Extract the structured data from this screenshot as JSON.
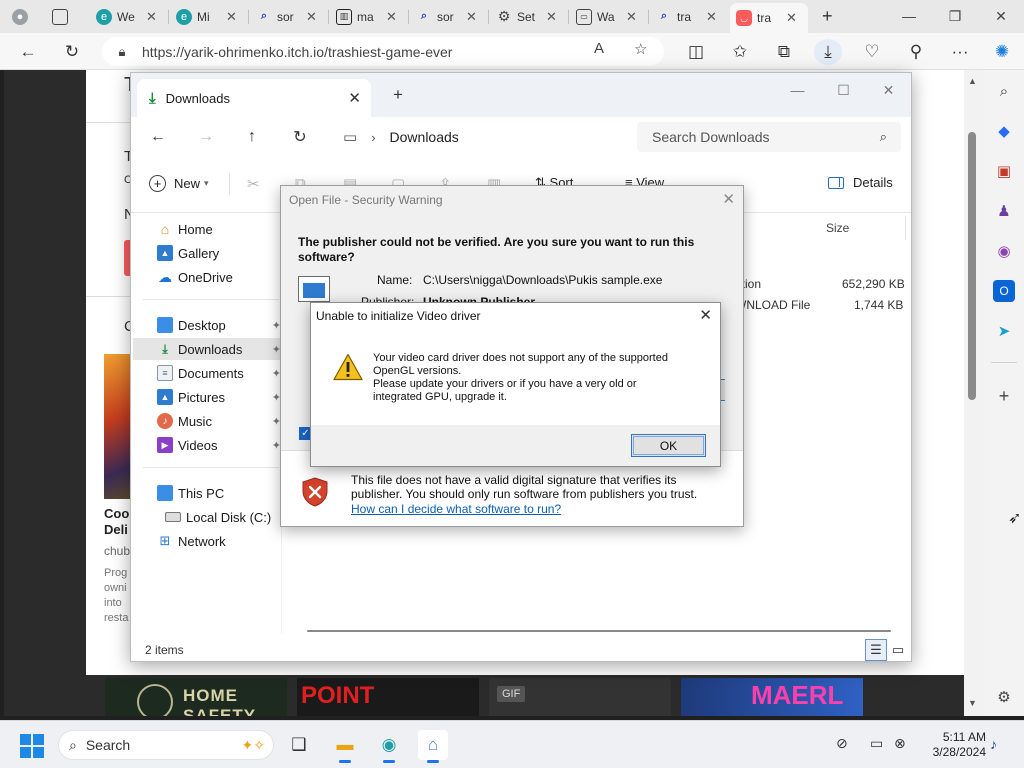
{
  "browser": {
    "tabs": [
      {
        "title": "We",
        "icon": "edge-icon"
      },
      {
        "title": "Mi",
        "icon": "edge-icon"
      },
      {
        "title": "sor",
        "icon": "search-icon"
      },
      {
        "title": "ma",
        "icon": "museum-icon"
      },
      {
        "title": "sor",
        "icon": "search-icon"
      },
      {
        "title": "Set",
        "icon": "gear-icon"
      },
      {
        "title": "Wa",
        "icon": "wallet-icon"
      },
      {
        "title": "tra",
        "icon": "search-icon"
      },
      {
        "title": "tra",
        "icon": "itch-icon"
      }
    ],
    "url": "https://yarik-ohrimenko.itch.io/trashiest-game-ever"
  },
  "page": {
    "card_left_title": "Coo",
    "card_left_title2": "Deli",
    "card_left_author": "chub",
    "card_left_desc": [
      "Prog",
      "owni",
      "into",
      "resta"
    ],
    "letter_t1": "T",
    "letter_t2": "T",
    "letter_c1": "C",
    "letter_n": "N",
    "letter_c2": "C",
    "thumbs": [
      "HOME SAFETY",
      "POINT",
      "GIF",
      "MAERL"
    ]
  },
  "explorer": {
    "tab_title": "Downloads",
    "breadcrumb": "Downloads",
    "search_placeholder": "Search Downloads",
    "new_label": "New",
    "sort_label": "Sort",
    "view_label": "View",
    "details_label": "Details",
    "nav": {
      "home": "Home",
      "gallery": "Gallery",
      "onedrive": "OneDrive",
      "desktop": "Desktop",
      "downloads": "Downloads",
      "documents": "Documents",
      "pictures": "Pictures",
      "music": "Music",
      "videos": "Videos",
      "this_pc": "This PC",
      "local_disk": "Local Disk (C:)",
      "network": "Network"
    },
    "column_size": "Size",
    "rows": [
      {
        "type": "ation",
        "size": "652,290 KB"
      },
      {
        "type": "WNLOAD File",
        "size": "1,744 KB"
      }
    ],
    "status": "2 items"
  },
  "security_warning": {
    "title": "Open File - Security Warning",
    "question": "The publisher could not be verified.  Are you sure you want to run this software?",
    "name_label": "Name:",
    "name_value": "C:\\Users\\nigga\\Downloads\\Pukis sample.exe",
    "publisher_label": "Publisher:",
    "publisher_value": "Unknown Publisher",
    "message": "This file does not have a valid digital signature that verifies its publisher.  You should only run software from publishers you trust.",
    "link": "How can I decide what software to run?"
  },
  "video_error": {
    "title": "Unable to initialize Video driver",
    "message_line1": "Your video card driver does not support any of the supported",
    "message_line2": "OpenGL versions.",
    "message_line3": "Please update your drivers or if you have a very old or",
    "message_line4": "integrated GPU, upgrade it.",
    "ok_label": "OK"
  },
  "taskbar": {
    "search_label": "Search",
    "time": "5:11 AM",
    "date": "3/28/2024"
  },
  "colors": {
    "accent": "#1a66c8",
    "explorer_title_bg": "#eef2f7",
    "link": "#0b5fb3"
  }
}
